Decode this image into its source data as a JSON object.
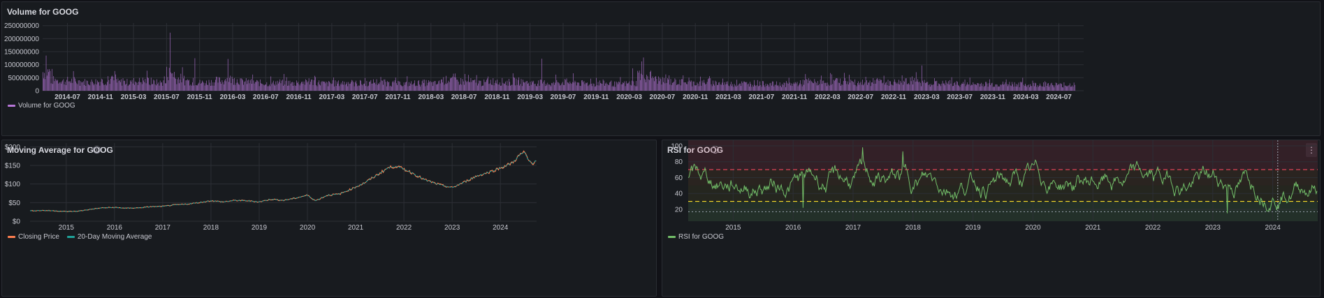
{
  "colors": {
    "background": "#111217",
    "panel": "#181b1f",
    "volume": "#b877d9",
    "closing": "#ff7f50",
    "moving_avg": "#1fa39a",
    "rsi": "#73bf69",
    "overbought": "#f2495c",
    "oversold": "#fade2a",
    "grid": "#2c2f35"
  },
  "volume_panel": {
    "title": "Volume for GOOG",
    "legend": "Volume for GOOG"
  },
  "ma_panel": {
    "title": "Moving Average for GOOG",
    "legend_close": "Closing Price",
    "legend_ma": "20-Day Moving Average"
  },
  "rsi_panel": {
    "title": "RSI for GOOG",
    "legend": "RSI for GOOG"
  },
  "chart_data": [
    {
      "type": "bar",
      "title": "Volume for GOOG",
      "series": [
        {
          "name": "Volume for GOOG"
        }
      ],
      "y_ticks": [
        0,
        50000000,
        100000000,
        150000000,
        200000000,
        250000000
      ],
      "y_tick_labels": [
        "0",
        "50000000",
        "100000000",
        "150000000",
        "200000000",
        "250000000"
      ],
      "ylim": [
        0,
        260000000
      ],
      "x_ticks": [
        "2014-07",
        "2014-11",
        "2015-03",
        "2015-07",
        "2015-11",
        "2016-03",
        "2016-07",
        "2016-11",
        "2017-03",
        "2017-07",
        "2017-11",
        "2018-03",
        "2018-07",
        "2018-11",
        "2019-03",
        "2019-07",
        "2019-11",
        "2020-03",
        "2020-07",
        "2020-11",
        "2021-03",
        "2021-07",
        "2021-11",
        "2022-03",
        "2022-07",
        "2022-11",
        "2023-03",
        "2023-07",
        "2023-11",
        "2024-03",
        "2024-07"
      ],
      "xlim": [
        "2014-04",
        "2024-10"
      ],
      "monthly_average_volume": [
        72000000,
        40000000,
        36000000,
        38000000,
        34000000,
        33000000,
        35000000,
        36000000,
        40000000,
        33000000,
        32000000,
        36000000,
        38000000,
        31000000,
        30000000,
        68000000,
        46000000,
        36000000,
        32000000,
        31000000,
        34000000,
        38000000,
        44000000,
        40000000,
        34000000,
        32000000,
        30000000,
        28000000,
        32000000,
        30000000,
        28000000,
        31000000,
        34000000,
        30000000,
        27000000,
        28000000,
        30000000,
        28000000,
        27000000,
        29000000,
        33000000,
        30000000,
        28000000,
        26000000,
        27000000,
        29000000,
        30000000,
        27000000,
        40000000,
        46000000,
        36000000,
        34000000,
        32000000,
        30000000,
        36000000,
        34000000,
        32000000,
        36000000,
        31000000,
        29000000,
        30000000,
        26000000,
        32000000,
        33000000,
        31000000,
        28000000,
        26000000,
        30000000,
        28000000,
        25000000,
        27000000,
        29000000,
        62000000,
        56000000,
        42000000,
        36000000,
        34000000,
        32000000,
        30000000,
        28000000,
        34000000,
        30000000,
        27000000,
        26000000,
        28000000,
        27000000,
        29000000,
        26000000,
        25000000,
        24000000,
        26000000,
        28000000,
        34000000,
        32000000,
        30000000,
        33000000,
        34000000,
        36000000,
        30000000,
        31000000,
        32000000,
        34000000,
        30000000,
        32000000,
        38000000,
        34000000,
        30000000,
        28000000,
        27000000,
        29000000,
        26000000,
        25000000,
        24000000,
        26000000,
        25000000,
        23000000,
        25000000,
        26000000,
        24000000,
        22000000,
        24000000,
        26000000,
        23000000,
        21000000,
        23000000
      ],
      "notable_peaks": [
        {
          "date": "2014-04",
          "value": 135000000
        },
        {
          "date": "2015-07",
          "value": 223000000
        },
        {
          "date": "2015-10",
          "value": 125000000
        },
        {
          "date": "2016-02",
          "value": 122000000
        },
        {
          "date": "2019-04",
          "value": 123000000
        },
        {
          "date": "2020-03",
          "value": 86000000
        },
        {
          "date": "2023-02",
          "value": 97000000
        }
      ]
    },
    {
      "type": "line",
      "title": "Moving Average for GOOG",
      "series": [
        {
          "name": "Closing Price"
        },
        {
          "name": "20-Day Moving Average"
        }
      ],
      "y_ticks": [
        0,
        50,
        100,
        150,
        200
      ],
      "y_tick_labels": [
        "$0",
        "$50",
        "$100",
        "$150",
        "$200"
      ],
      "ylim": [
        0,
        210
      ],
      "x_ticks": [
        "2015",
        "2016",
        "2017",
        "2018",
        "2019",
        "2020",
        "2021",
        "2022",
        "2023",
        "2024"
      ],
      "x": [
        "2014-04",
        "2014-07",
        "2014-10",
        "2015-01",
        "2015-04",
        "2015-07",
        "2015-10",
        "2016-01",
        "2016-04",
        "2016-07",
        "2016-10",
        "2017-01",
        "2017-04",
        "2017-07",
        "2017-10",
        "2018-01",
        "2018-04",
        "2018-07",
        "2018-10",
        "2019-01",
        "2019-04",
        "2019-07",
        "2019-10",
        "2020-01",
        "2020-03",
        "2020-06",
        "2020-09",
        "2020-12",
        "2021-03",
        "2021-06",
        "2021-09",
        "2021-11",
        "2022-01",
        "2022-03",
        "2022-06",
        "2022-09",
        "2022-11",
        "2023-01",
        "2023-04",
        "2023-07",
        "2023-10",
        "2024-01",
        "2024-04",
        "2024-06",
        "2024-07",
        "2024-08",
        "2024-09",
        "2024-10"
      ],
      "values": [
        28,
        29,
        28,
        26,
        27,
        32,
        36,
        37,
        35,
        36,
        39,
        40,
        44,
        46,
        50,
        55,
        52,
        56,
        55,
        52,
        59,
        56,
        62,
        70,
        55,
        70,
        73,
        87,
        102,
        122,
        143,
        148,
        140,
        130,
        112,
        101,
        95,
        90,
        105,
        121,
        131,
        143,
        157,
        180,
        185,
        163,
        155,
        165
      ]
    },
    {
      "type": "line",
      "title": "RSI for GOOG",
      "series": [
        {
          "name": "RSI for GOOG"
        }
      ],
      "y_ticks": [
        20,
        40,
        60,
        80,
        100
      ],
      "y_tick_labels": [
        "20",
        "40",
        "60",
        "80",
        "100"
      ],
      "ylim": [
        5,
        107
      ],
      "x_ticks": [
        "2015",
        "2016",
        "2017",
        "2018",
        "2019",
        "2020",
        "2021",
        "2022",
        "2023",
        "2024"
      ],
      "thresholds": {
        "overbought": 70,
        "oversold": 30,
        "lower_reference": 17
      },
      "crosshair_date": "2024-02",
      "oscillation_range": [
        14,
        98
      ],
      "notable_points": [
        {
          "date": "2017-03",
          "value": 98
        },
        {
          "date": "2017-11",
          "value": 93
        },
        {
          "date": "2016-03",
          "value": 22
        },
        {
          "date": "2021-01",
          "value": 15
        },
        {
          "date": "2023-04",
          "value": 15
        }
      ]
    }
  ]
}
